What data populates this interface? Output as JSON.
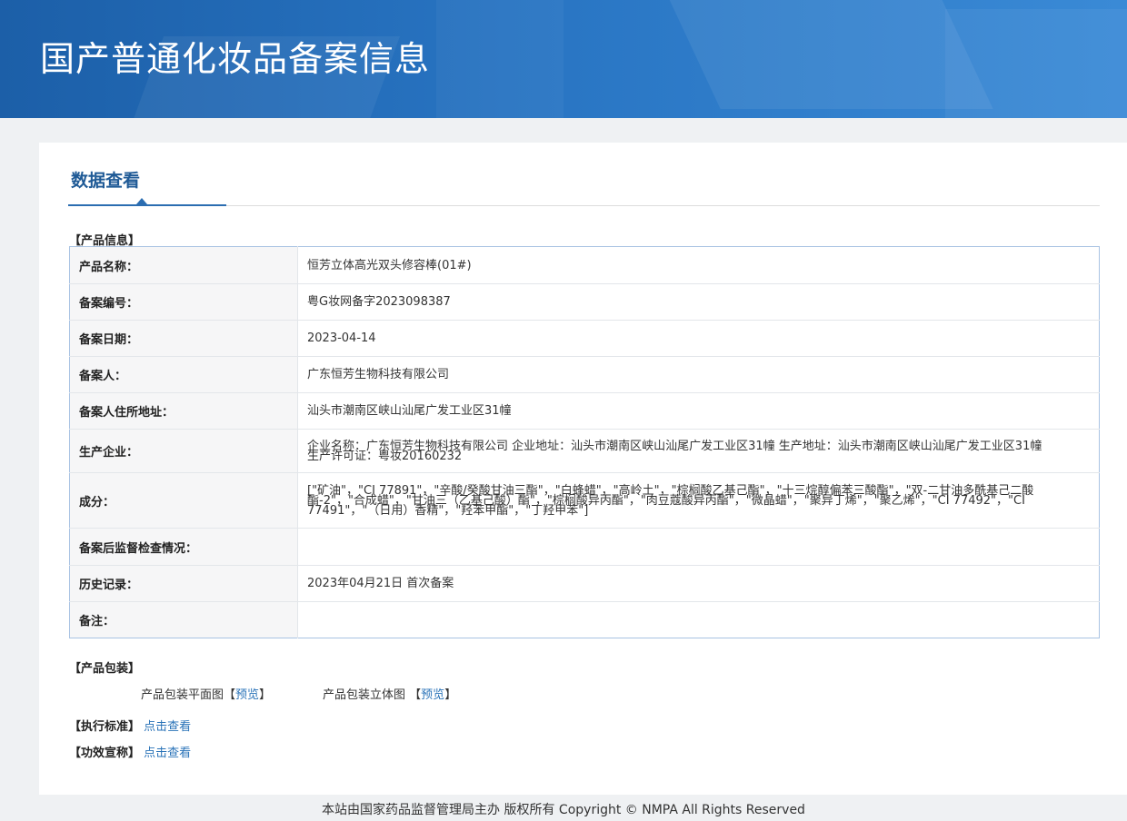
{
  "header": {
    "title": "国产普通化妆品备案信息"
  },
  "tab": {
    "label": "数据查看"
  },
  "product_info": {
    "section_title": "【产品信息】",
    "rows": [
      {
        "label": "产品名称：",
        "value": "恒芳立体高光双头修容棒(01#)"
      },
      {
        "label": "备案编号：",
        "value": "粤G妆网备字2023098387"
      },
      {
        "label": "备案日期：",
        "value": "2023-04-14"
      },
      {
        "label": "备案人：",
        "value": "广东恒芳生物科技有限公司"
      },
      {
        "label": "备案人住所地址：",
        "value": "汕头市潮南区峡山汕尾广发工业区31幢"
      },
      {
        "label": "生产企业：",
        "value": "企业名称：广东恒芳生物科技有限公司 企业地址：汕头市潮南区峡山汕尾广发工业区31幢 生产地址：汕头市潮南区峡山汕尾广发工业区31幢 生产许可证：粤妆20160232"
      },
      {
        "label": "成分：",
        "value": "[\"矿油\"，\"CI 77891\"，\"辛酸/癸酸甘油三酯\"，\"白蜂蜡\"，\"高岭土\"，\"棕榈酸乙基己酯\"，\"十三烷醇偏苯三酸酯\"，\"双-二甘油多酰基己二酸酯-2\"，\"合成蜡\"，\"甘油三（乙基己酸）酯\"，\"棕榈酸异丙酯\"，\"肉豆蔻酸异丙酯\"，\"微晶蜡\"，\"聚异丁烯\"，\"聚乙烯\"，\"CI 77492\"，\"CI 77491\"，\"（日用）香精\"，\"羟苯甲酯\"，\"丁羟甲苯\"]"
      },
      {
        "label": "备案后监督检查情况：",
        "value": ""
      },
      {
        "label": "历史记录：",
        "value": "2023年04月21日 首次备案"
      },
      {
        "label": "备注：",
        "value": ""
      }
    ]
  },
  "packaging": {
    "section_title": "【产品包装】",
    "flat_label": "产品包装平面图",
    "flat_link": "预览",
    "stereo_label": "产品包装立体图",
    "stereo_link": "预览",
    "bracket_open": "【",
    "bracket_close": "】"
  },
  "standard": {
    "label": "【执行标准】",
    "link": "点击查看"
  },
  "efficacy": {
    "label": "【功效宣称】",
    "link": "点击查看"
  },
  "footer": {
    "text": "本站由国家药品监督管理局主办 版权所有 Copyright © NMPA All Rights Reserved"
  },
  "colors": {
    "banner": "#2874c2",
    "accent": "#1f5a96",
    "link": "#2a73b8"
  }
}
